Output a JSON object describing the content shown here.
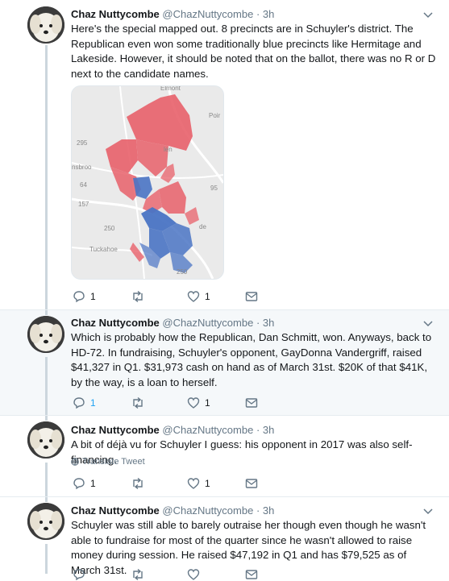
{
  "tweets": [
    {
      "name": "Chaz Nuttycombe",
      "handle": "@ChazNuttycombe",
      "time": "3h",
      "text": "Here's the special mapped out. 8 precincts are in Schuyler's district. The Republican even won some traditionally blue precincts like Hermitage and Lakeside. However, it should be noted that on the ballot, there was no R or D next to the candidate names.",
      "map_labels": [
        "Elmont",
        "Poir",
        "295",
        "nsbroo",
        "len",
        "64",
        "95",
        "157",
        "250",
        "de",
        "Tuckahoe",
        "250"
      ],
      "replies": "1",
      "retweets": "",
      "likes": "1"
    },
    {
      "name": "Chaz Nuttycombe",
      "handle": "@ChazNuttycombe",
      "time": "3h",
      "text": "Which is probably how the Republican, Dan Schmitt, won. Anyways, back to HD-72. In fundraising, Schuyler's opponent, GayDonna Vandergriff, raised $41,327 in Q1. $31,973 cash on hand as of March 31st. $20K of that $41K, by the way, is a loan to herself.",
      "replies": "1",
      "retweets": "",
      "likes": "1"
    },
    {
      "name": "Chaz Nuttycombe",
      "handle": "@ChazNuttycombe",
      "time": "3h",
      "text": "A bit of déjà vu for Schuyler I guess: his opponent in 2017 was also self-financing.",
      "translate": "Translate Tweet",
      "replies": "1",
      "retweets": "",
      "likes": "1"
    },
    {
      "name": "Chaz Nuttycombe",
      "handle": "@ChazNuttycombe",
      "time": "3h",
      "text": "Schuyler was still able to barely outraise her though even though he wasn't able to fundraise for most of the quarter since he wasn't allowed to raise money during session. He raised $47,192 in Q1 and has $79,525 as of March 31st."
    }
  ],
  "colors": {
    "republican": "#e8606a",
    "democrat": "#4a74c4",
    "accent": "#1da1f2",
    "thread": "#ccd6dd"
  },
  "icons": [
    "reply-icon",
    "retweet-icon",
    "like-icon",
    "dm-icon",
    "caret-down-icon",
    "globe-icon"
  ]
}
